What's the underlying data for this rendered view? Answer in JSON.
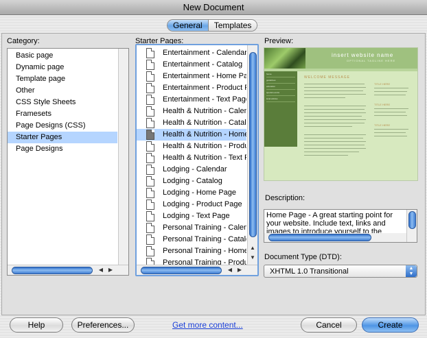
{
  "window": {
    "title": "New Document"
  },
  "tabs": [
    {
      "label": "General",
      "active": true
    },
    {
      "label": "Templates",
      "active": false
    }
  ],
  "category": {
    "label": "Category:",
    "items": [
      "Basic page",
      "Dynamic page",
      "Template page",
      "Other",
      "CSS Style Sheets",
      "Framesets",
      "Page Designs (CSS)",
      "Starter Pages",
      "Page Designs"
    ],
    "selected_index": 7
  },
  "starter": {
    "label": "Starter Pages:",
    "items": [
      "Entertainment - Calendar",
      "Entertainment - Catalog",
      "Entertainment - Home Page",
      "Entertainment - Product Page",
      "Entertainment - Text Page",
      "Health & Nutrition - Calendar",
      "Health & Nutrition - Catalog",
      "Health & Nutrition - Home Page",
      "Health & Nutrition - Product Page",
      "Health & Nutrition - Text Page",
      "Lodging - Calendar",
      "Lodging - Catalog",
      "Lodging - Home Page",
      "Lodging - Product Page",
      "Lodging - Text Page",
      "Personal Training - Calendar",
      "Personal Training - Catalog",
      "Personal Training - Home Page",
      "Personal Training - Product Page"
    ],
    "selected_index": 7
  },
  "preview": {
    "label": "Preview:",
    "site_name": "insert website name",
    "tagline": "OPTIONAL TAGLINE HERE",
    "section_heading": "WELCOME MESSAGE",
    "nav_items": [
      "home",
      "guidelines",
      "education",
      "special events",
      "local articles"
    ],
    "sidebar_headings": [
      "TITLE HERE",
      "TITLE HERE",
      "TITLE HERE"
    ]
  },
  "description": {
    "label": "Description:",
    "text": "Home Page - A great starting point for your website. Include text, links and images to introduce yourself to the world. Layout is"
  },
  "doctype": {
    "label": "Document Type (DTD):",
    "value": "XHTML 1.0 Transitional"
  },
  "buttons": {
    "help": "Help",
    "preferences": "Preferences...",
    "get_more": "Get more content...",
    "cancel": "Cancel",
    "create": "Create"
  }
}
